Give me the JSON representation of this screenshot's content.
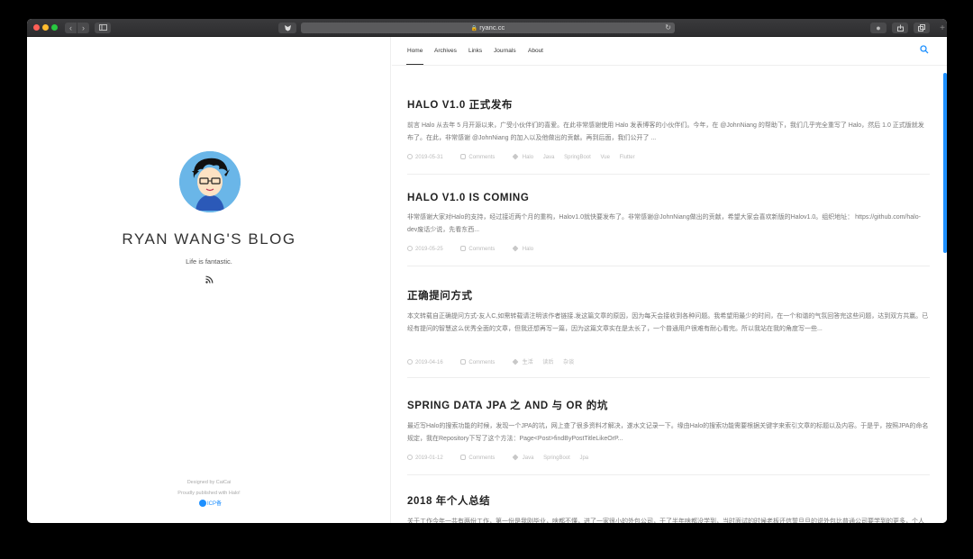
{
  "browser": {
    "url": "ryanc.cc",
    "icons": {
      "back": "chevron-left-icon",
      "forward": "chevron-right-icon",
      "sidebar": "sidebar-icon",
      "shield": "shield-icon",
      "lock": "lock-icon",
      "reload": "reload-icon",
      "info": "info-icon",
      "share": "share-icon",
      "tabs": "tabs-icon"
    }
  },
  "profile": {
    "title": "RYAN WANG'S BLOG",
    "description": "Life is fantastic.",
    "footer_designed": "Designed by CaiCai",
    "footer_powered": "Proudly published with Halo!",
    "badge": "ICP备"
  },
  "nav": {
    "items": [
      "Home",
      "Archives",
      "Links",
      "Journals",
      "About"
    ]
  },
  "posts": [
    {
      "title": "HALO V1.0 正式发布",
      "excerpt": "前言 Halo 从去年 5 月开源以来，广受小伙伴们的喜爱。在此非常感谢使用 Halo 发表博客的小伙伴们。今年，在 @JohnNiang 的帮助下，我们几乎完全重写了 Halo，然后 1.0 正式版就发布了。在此，非常感谢 @JohnNiang 的加入以及他做出的贡献。再到后面，我们公开了 ...",
      "date": "2019-05-31",
      "comments": "Comments",
      "tags": [
        "Halo",
        "Java",
        "SpringBoot",
        "Vue",
        "Flutter"
      ]
    },
    {
      "title": "HALO V1.0 IS COMING",
      "excerpt": "非常感谢大家对Halo的支持，经过接近两个月的重构，Halov1.0就快要发布了。非常感谢@JohnNiang做出的贡献，希望大家会喜欢新版的Halov1.0。组织地址： https://github.com/halo-dev废话少说，先看东西...",
      "date": "2019-05-25",
      "comments": "Comments",
      "tags": [
        "Halo"
      ]
    },
    {
      "title": "正确提问方式",
      "excerpt": "本文转载自正确提问方式-友人C,如需转载请注明该作者链接.发这篇文章的原因，因为每天会接收到各种问题。我希望用最少的时间，在一个和谐的气氛回答完这些问题，达到双方共赢。已经有提问的智慧这么优秀全面的文章，但我还想再写一篇，因为这篇文章实在是太长了，一个普通用户很难有耐心看完。所以我站在我的角度写一些...",
      "date": "2019-04-16",
      "comments": "Comments",
      "tags": [
        "生活",
        "读后",
        "杂谈"
      ]
    },
    {
      "title": "SPRING DATA JPA 之 AND 与 OR 的坑",
      "excerpt": "最近写Halo的搜索功能的时候，发现一个JPA的坑，网上查了很多资料才解决，遂水文记录一下。缘由Halo的搜索功能需要根据关键字来索引文章的标题以及内容。于是乎，按照JPA的命名规定，我在Repository下写了这个方法：Page<Post>findByPostTitleLikeOrP...",
      "date": "2019-01-12",
      "comments": "Comments",
      "tags": [
        "Java",
        "SpringBoot",
        "Jpa"
      ]
    },
    {
      "title": "2018 年个人总结",
      "excerpt": "关于工作今年一共有两份工作，第一份是我刚毕业，啥都不懂，进了一家很小的外包公司，干了半年啥都没学到，当时面试的时候老板还信誓旦旦的说外包比普通公司要学到的更多，个人能力也提升的更快，可当我进去干了一段时间才知道，公司现有的技术可能还没我所掌握的技术多，于是乎，到了8月份就",
      "date": "",
      "comments": "",
      "tags": []
    }
  ]
}
